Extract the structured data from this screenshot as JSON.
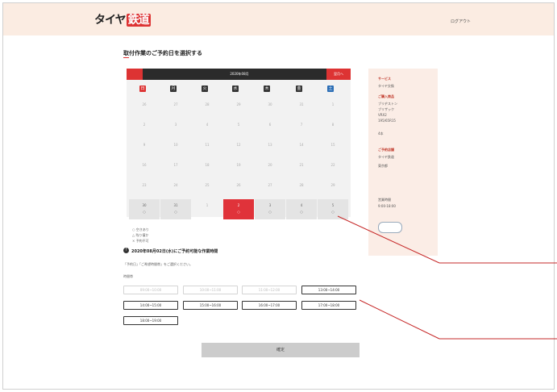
{
  "header": {
    "logo_main": "タイヤ",
    "logo_accent": "鉄道",
    "login": "ログアウト"
  },
  "page": {
    "title": "取付作業のご予約日を選択する"
  },
  "calendar": {
    "month": "2020年08月",
    "next_label": "翌月へ",
    "weekdays": [
      "日",
      "月",
      "火",
      "水",
      "木",
      "金",
      "土"
    ],
    "weeks": [
      [
        "26",
        "27",
        "28",
        "29",
        "30",
        "31",
        "1"
      ],
      [
        "2",
        "3",
        "4",
        "5",
        "6",
        "7",
        "8"
      ],
      [
        "9",
        "10",
        "11",
        "12",
        "13",
        "14",
        "15"
      ],
      [
        "16",
        "17",
        "18",
        "19",
        "20",
        "21",
        "22"
      ],
      [
        "23",
        "24",
        "25",
        "26",
        "27",
        "28",
        "29"
      ],
      [
        "30",
        "31",
        "1",
        "2",
        "3",
        "4",
        "5"
      ]
    ],
    "last_week_marks": [
      "○",
      "○",
      "",
      "○",
      "○",
      "○",
      "○"
    ]
  },
  "legend": [
    "○ 空きあり",
    "△ 残り僅か",
    "× 予約不可"
  ],
  "selected_info": {
    "title": "2020年08月02日(水)にご予約可能な作業時間",
    "note": "「予約日」「ご希望時間帯」をご選択ください。",
    "time_label": "時間帯"
  },
  "slots": [
    {
      "label": "09:00~10:00",
      "enabled": false
    },
    {
      "label": "10:00~11:00",
      "enabled": false
    },
    {
      "label": "11:00~12:00",
      "enabled": false
    },
    {
      "label": "13:00~14:00",
      "enabled": true
    },
    {
      "label": "14:00~15:00",
      "enabled": true
    },
    {
      "label": "15:00~16:00",
      "enabled": true
    },
    {
      "label": "16:00~17:00",
      "enabled": true
    },
    {
      "label": "17:00~18:00",
      "enabled": true
    },
    {
      "label": "18:00~19:00",
      "enabled": true
    }
  ],
  "confirm_label": "確定",
  "side": {
    "h1": "サービス",
    "t1": "タイヤ交換",
    "h2": "ご購入商品",
    "t2a": "ブリヂストン",
    "t2b": "ブリザック",
    "t2c": "VRX2",
    "t2d": "195/65R15",
    "t2e": "4本",
    "h3": "ご予約店舗",
    "t3a": "タイヤ鉄道",
    "t3b": "東京都",
    "t3c": "営業時間",
    "t3d": "9:00-18:00"
  },
  "colors": {
    "brand_red": "#e0333a",
    "header_bg": "#fbece2",
    "sidebar_bg": "#fbede6",
    "saturday_blue": "#2a6db5"
  }
}
